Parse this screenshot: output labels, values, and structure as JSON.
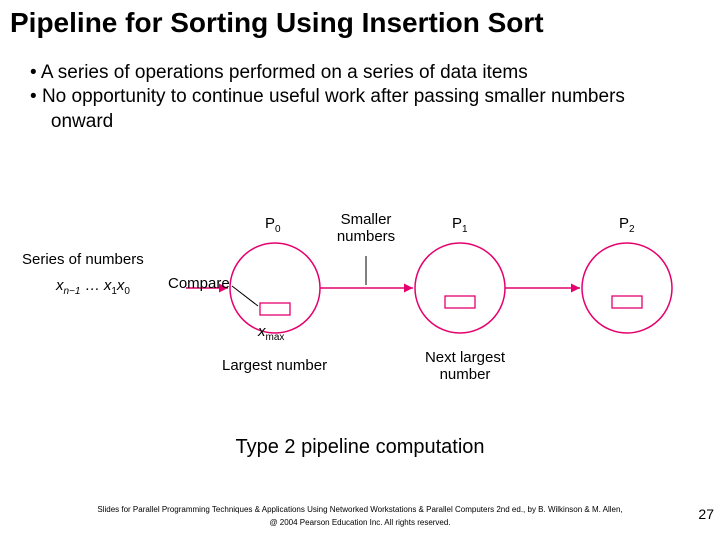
{
  "title": "Pipeline for Sorting Using Insertion Sort",
  "bullets": [
    "A series of operations performed on a series of data items",
    "No opportunity to continue useful work after passing smaller numbers onward"
  ],
  "diagram": {
    "series_label": "Series of numbers",
    "xn1": "x",
    "xn1_sub": "n−1",
    "dots": "…",
    "x1": "x",
    "x1_sub": "1",
    "x0": "x",
    "x0_sub": "0",
    "p0": "P",
    "p0_sub": "0",
    "p1": "P",
    "p1_sub": "1",
    "p2": "P",
    "p2_sub": "2",
    "smaller": "Smaller\nnumbers",
    "compare": "Compare",
    "xmax": "x",
    "xmax_sub": "max",
    "largest": "Largest number",
    "next_largest": "Next largest\nnumber"
  },
  "caption": "Type 2 pipeline computation",
  "footer1": "Slides for Parallel Programming Techniques & Applications Using Networked Workstations & Parallel Computers 2nd ed., by B. Wilkinson & M. Allen,",
  "footer2": "@ 2004 Pearson Education Inc. All rights reserved.",
  "page": "27"
}
